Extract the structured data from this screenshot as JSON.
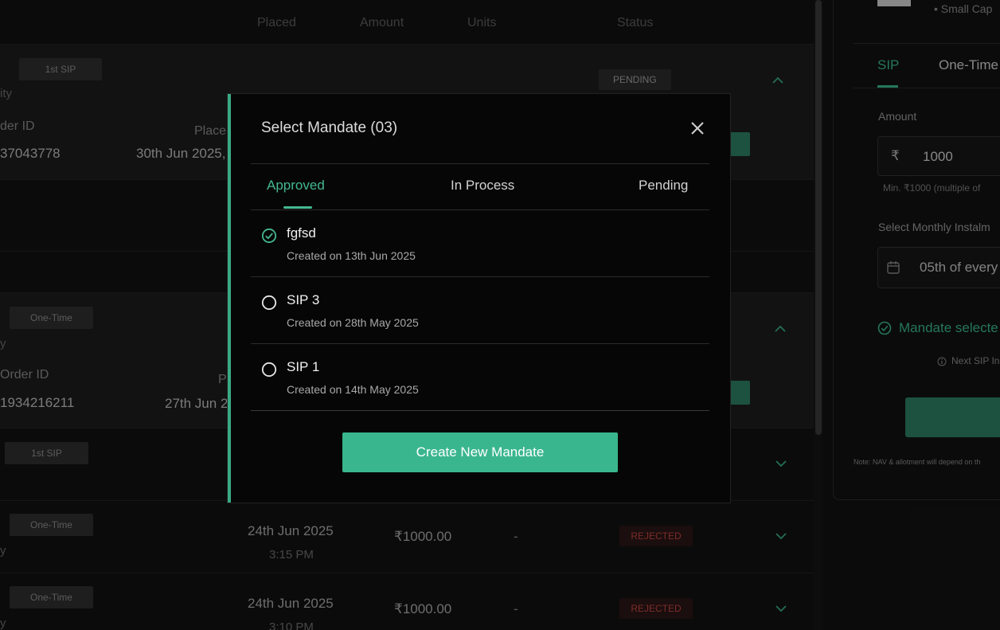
{
  "table_header": {
    "placed": "Placed",
    "amount": "Amount",
    "units": "Units",
    "status": "Status"
  },
  "orders": [
    {
      "tag": "1st SIP",
      "category": "ity",
      "order_id_label": "der ID",
      "order_id": "37043778",
      "placed_label": "Place",
      "placed_date": "30th Jun 2025,",
      "status": "PENDING"
    },
    {
      "tag": "One-Time",
      "category": "y",
      "order_id_label": "Order ID",
      "order_id": "1934216211",
      "placed_label": "P",
      "placed_date": "27th Jun 2"
    },
    {
      "tag": "1st SIP"
    },
    {
      "tag": "One-Time",
      "category": "y",
      "date": "24th Jun 2025",
      "time": "3:15 PM",
      "amount": "₹1000.00",
      "units": "-",
      "status": "REJECTED"
    },
    {
      "tag": "One-Time",
      "category": "y",
      "date": "24th Jun 2025",
      "time": "3:10 PM",
      "amount": "₹1000.00",
      "units": "-",
      "status": "REJECTED"
    }
  ],
  "right_panel": {
    "bullet": "Small Cap",
    "tabs": [
      "SIP",
      "One-Time"
    ],
    "amount_label": "Amount",
    "currency": "₹",
    "amount_value": "1000",
    "min_note": "Min. ₹1000 (multiple of",
    "instalment_label": "Select Monthly Instalm",
    "instalment_value": "05th of every",
    "mandate_selected": "Mandate selecte",
    "next_sip": "Next SIP In",
    "note": "Note: NAV & allotment will depend on th"
  },
  "modal": {
    "title": "Select Mandate (03)",
    "tabs": [
      {
        "label": "Approved",
        "active": true
      },
      {
        "label": "In Process",
        "active": false
      },
      {
        "label": "Pending",
        "active": false
      }
    ],
    "mandates": [
      {
        "name": "fgfsd",
        "created": "Created on 13th Jun 2025",
        "selected": true
      },
      {
        "name": "SIP 3",
        "created": "Created on 28th May 2025",
        "selected": false
      },
      {
        "name": "SIP 1",
        "created": "Created on 14th May 2025",
        "selected": false
      }
    ],
    "create_button": "Create New Mandate"
  },
  "colors": {
    "accent": "#3ab68e",
    "rejected": "#c0443f",
    "background": "#121212",
    "modal_bg": "#060606"
  },
  "icons": {
    "close": "close-icon",
    "check": "check-circle-icon",
    "radio": "radio-empty-icon",
    "chevron_up": "chevron-up-icon",
    "chevron_down": "chevron-down-icon",
    "calendar": "calendar-icon",
    "info": "info-icon"
  }
}
